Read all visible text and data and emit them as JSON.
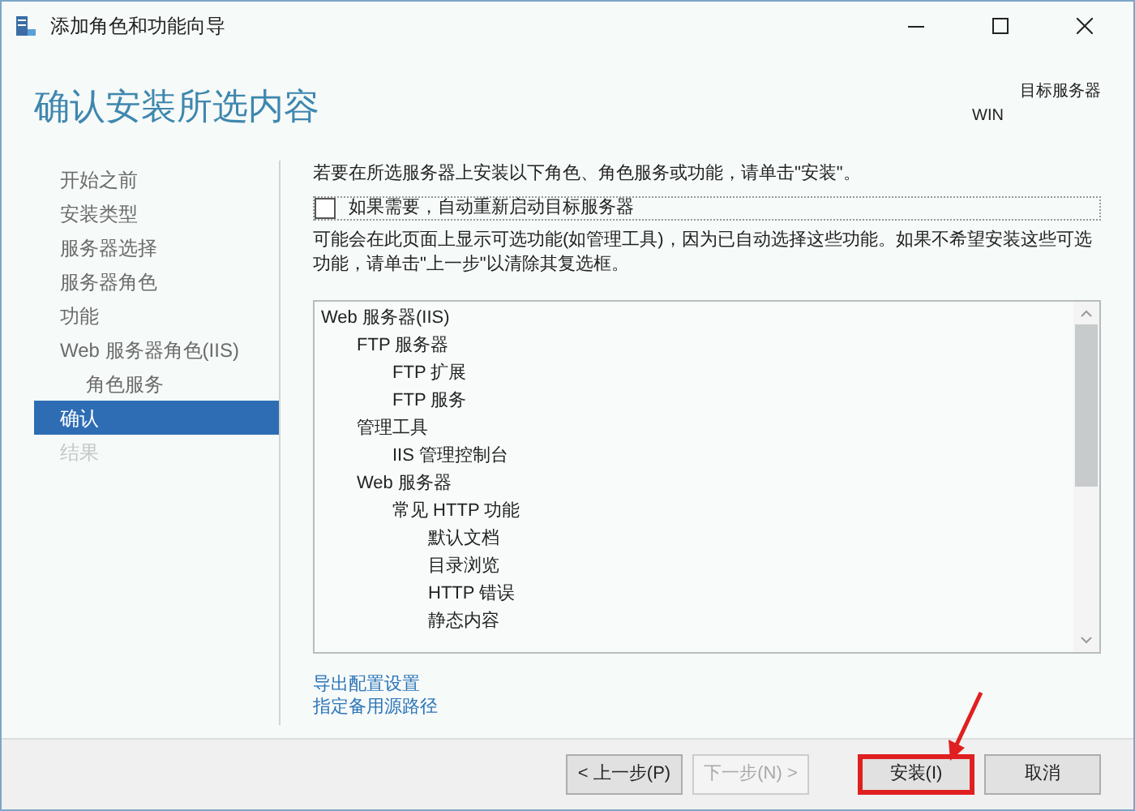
{
  "window": {
    "title": "添加角色和功能向导"
  },
  "header": {
    "title": "确认安装所选内容",
    "target_label": "目标服务器",
    "target_server": "WIN"
  },
  "sidebar": {
    "items": [
      {
        "label": "开始之前",
        "selected": false,
        "disabled": false,
        "indented": false
      },
      {
        "label": "安装类型",
        "selected": false,
        "disabled": false,
        "indented": false
      },
      {
        "label": "服务器选择",
        "selected": false,
        "disabled": false,
        "indented": false
      },
      {
        "label": "服务器角色",
        "selected": false,
        "disabled": false,
        "indented": false
      },
      {
        "label": "功能",
        "selected": false,
        "disabled": false,
        "indented": false
      },
      {
        "label": "Web 服务器角色(IIS)",
        "selected": false,
        "disabled": false,
        "indented": false
      },
      {
        "label": "角色服务",
        "selected": false,
        "disabled": false,
        "indented": true
      },
      {
        "label": "确认",
        "selected": true,
        "disabled": false,
        "indented": false
      },
      {
        "label": "结果",
        "selected": false,
        "disabled": true,
        "indented": false
      }
    ]
  },
  "intro": "若要在所选服务器上安装以下角色、角色服务或功能，请单击\"安装\"。",
  "restart_option": {
    "label": "如果需要，自动重新启动目标服务器",
    "checked": false
  },
  "note": "可能会在此页面上显示可选功能(如管理工具)，因为已自动选择这些功能。如果不希望安装这些可选功能，请单击\"上一步\"以清除其复选框。",
  "features": [
    {
      "label": "Web 服务器(IIS)",
      "children": [
        {
          "label": "FTP 服务器",
          "children": [
            {
              "label": "FTP 扩展"
            },
            {
              "label": "FTP 服务"
            }
          ]
        },
        {
          "label": "管理工具",
          "children": [
            {
              "label": "IIS 管理控制台"
            }
          ]
        },
        {
          "label": "Web 服务器",
          "children": [
            {
              "label": "常见 HTTP 功能",
              "children": [
                {
                  "label": "默认文档"
                },
                {
                  "label": "目录浏览"
                },
                {
                  "label": "HTTP 错误"
                },
                {
                  "label": "静态内容"
                }
              ]
            }
          ]
        }
      ]
    }
  ],
  "links": [
    "导出配置设置",
    "指定备用源路径"
  ],
  "buttons": [
    {
      "label": "< 上一步(P)",
      "disabled": false,
      "highlighted": false
    },
    {
      "label": "下一步(N) >",
      "disabled": true,
      "highlighted": false
    },
    {
      "label": "安装(I)",
      "disabled": false,
      "highlighted": true
    },
    {
      "label": "取消",
      "disabled": false,
      "highlighted": false
    }
  ]
}
